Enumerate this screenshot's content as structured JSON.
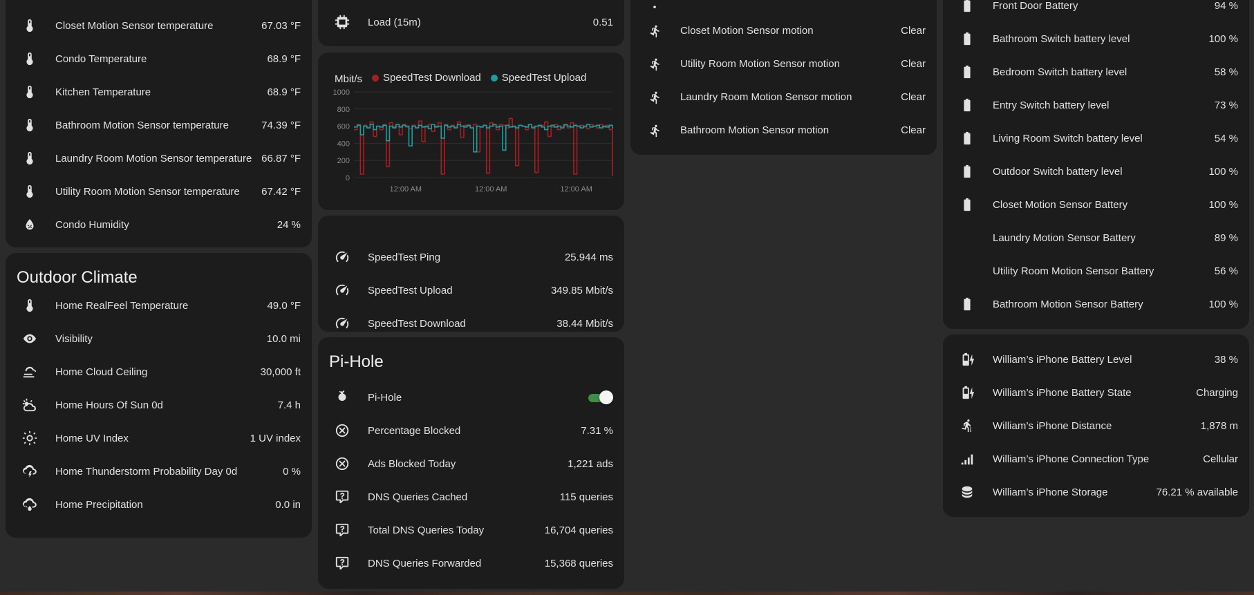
{
  "indoor": {
    "rows": [
      {
        "icon": "thermometer-icon",
        "label": "Closet Motion Sensor temperature",
        "value": "67.03 °F"
      },
      {
        "icon": "thermometer-icon",
        "label": "Condo Temperature",
        "value": "68.9 °F"
      },
      {
        "icon": "thermometer-icon",
        "label": "Kitchen Temperature",
        "value": "68.9 °F"
      },
      {
        "icon": "thermometer-icon",
        "label": "Bathroom Motion Sensor temperature",
        "value": "74.39 °F"
      },
      {
        "icon": "thermometer-icon",
        "label": "Laundry Room Motion Sensor temperature",
        "value": "66.87 °F"
      },
      {
        "icon": "thermometer-icon",
        "label": "Utility Room Motion Sensor temperature",
        "value": "67.42 °F"
      },
      {
        "icon": "water-percent-icon",
        "label": "Condo Humidity",
        "value": "24 %"
      }
    ]
  },
  "outdoor": {
    "title": "Outdoor Climate",
    "rows": [
      {
        "icon": "thermometer-icon",
        "label": "Home RealFeel Temperature",
        "value": "49.0 °F"
      },
      {
        "icon": "eye-icon",
        "label": "Visibility",
        "value": "10.0 mi"
      },
      {
        "icon": "weather-fog-icon",
        "label": "Home Cloud Ceiling",
        "value": "30,000 ft"
      },
      {
        "icon": "weather-partly-cloudy-icon",
        "label": "Home Hours Of Sun 0d",
        "value": "7.4 h"
      },
      {
        "icon": "sun-icon",
        "label": "Home UV Index",
        "value": "1 UV index"
      },
      {
        "icon": "weather-lightning-icon",
        "label": "Home Thunderstorm Probability Day 0d",
        "value": "0 %"
      },
      {
        "icon": "weather-rain-icon",
        "label": "Home Precipitation",
        "value": "0.0 in"
      }
    ]
  },
  "load": {
    "rows": [
      {
        "icon": "chip-icon",
        "label": "Load (15m)",
        "value": "0.51"
      }
    ]
  },
  "speedtest_chart": {
    "legend": [
      {
        "name": "SpeedTest Download",
        "color": "#a51e22"
      },
      {
        "name": "SpeedTest Upload",
        "color": "#1d9e9e"
      }
    ],
    "unit_label": "Mbit/s"
  },
  "chart_data": {
    "type": "line",
    "title": "",
    "ylabel": "Mbit/s",
    "ylim": [
      0,
      1000
    ],
    "yticks": [
      "1000",
      "800",
      "600",
      "400",
      "200",
      "0"
    ],
    "xticks": [
      "12:00 AM",
      "12:00 AM",
      "12:00 AM"
    ],
    "series": [
      {
        "name": "SpeedTest Download",
        "color": "#a51e22",
        "values": [
          560,
          620,
          40,
          610,
          580,
          650,
          480,
          600,
          560,
          620,
          130,
          640,
          590,
          600,
          500,
          620,
          590,
          570,
          610,
          580,
          660,
          420,
          590,
          620,
          540,
          600,
          640,
          40,
          620,
          560,
          610,
          590,
          650,
          470,
          610,
          600,
          580,
          620,
          300,
          590,
          610,
          50,
          640,
          600,
          560,
          620,
          610,
          580,
          690,
          590,
          140,
          610,
          600,
          560,
          620,
          590,
          60,
          600,
          610,
          650,
          480,
          590,
          620,
          560,
          600,
          610,
          580,
          640,
          40,
          600,
          610,
          590,
          570,
          620,
          600,
          580,
          620,
          590,
          610,
          560,
          20
        ]
      },
      {
        "name": "SpeedTest Upload",
        "color": "#1d9e9e",
        "values": [
          590,
          610,
          500,
          600,
          580,
          620,
          560,
          600,
          590,
          610,
          430,
          600,
          580,
          620,
          590,
          610,
          600,
          370,
          600,
          580,
          610,
          590,
          600,
          570,
          620,
          590,
          600,
          460,
          610,
          590,
          600,
          580,
          620,
          600,
          590,
          610,
          580,
          300,
          600,
          590,
          610,
          580,
          600,
          620,
          590,
          600,
          320,
          610,
          590,
          600,
          580,
          610,
          600,
          590,
          620,
          580,
          600,
          610,
          590,
          560,
          600,
          610,
          590,
          600,
          580,
          620,
          600,
          590,
          610,
          600,
          580,
          600,
          620,
          590,
          600,
          610,
          580,
          600,
          590,
          610,
          570
        ]
      }
    ]
  },
  "speedtest_stats": {
    "rows": [
      {
        "icon": "speedometer-icon",
        "label": "SpeedTest Ping",
        "value": "25.944 ms"
      },
      {
        "icon": "speedometer-icon",
        "label": "SpeedTest Upload",
        "value": "349.85 Mbit/s"
      },
      {
        "icon": "speedometer-icon",
        "label": "SpeedTest Download",
        "value": "38.44 Mbit/s"
      }
    ]
  },
  "pihole": {
    "title": "Pi-Hole",
    "toggle": {
      "icon": "pi-hole-icon",
      "label": "Pi-Hole",
      "state": "on"
    },
    "rows": [
      {
        "icon": "close-circle-icon",
        "label": "Percentage Blocked",
        "value": "7.31 %"
      },
      {
        "icon": "close-circle-icon",
        "label": "Ads Blocked Today",
        "value": "1,221 ads"
      },
      {
        "icon": "comment-question-icon",
        "label": "DNS Queries Cached",
        "value": "115 queries"
      },
      {
        "icon": "comment-question-icon",
        "label": "Total DNS Queries Today",
        "value": "16,704 queries"
      },
      {
        "icon": "comment-question-icon",
        "label": "DNS Queries Forwarded",
        "value": "15,368 queries"
      }
    ]
  },
  "motion": {
    "rows": [
      {
        "icon": "walk-icon",
        "label": "Closet Motion Sensor motion",
        "value": "Clear"
      },
      {
        "icon": "walk-icon",
        "label": "Utility Room Motion Sensor motion",
        "value": "Clear"
      },
      {
        "icon": "walk-icon",
        "label": "Laundry Room Motion Sensor motion",
        "value": "Clear"
      },
      {
        "icon": "walk-icon",
        "label": "Bathroom Motion Sensor motion",
        "value": "Clear"
      }
    ]
  },
  "batteries": {
    "rows": [
      {
        "icon": "battery-icon",
        "label": "Front Door Battery",
        "value": "94 %"
      },
      {
        "icon": "battery-icon",
        "label": "Bathroom Switch battery level",
        "value": "100 %"
      },
      {
        "icon": "battery-icon",
        "label": "Bedroom Switch battery level",
        "value": "58 %"
      },
      {
        "icon": "battery-icon",
        "label": "Entry Switch battery level",
        "value": "73 %"
      },
      {
        "icon": "battery-icon",
        "label": "Living Room Switch battery level",
        "value": "54 %"
      },
      {
        "icon": "battery-icon",
        "label": "Outdoor Switch battery level",
        "value": "100 %"
      },
      {
        "icon": "battery-icon",
        "label": "Closet Motion Sensor Battery",
        "value": "100 %"
      },
      {
        "icon": "",
        "label": "Laundry Motion Sensor Battery",
        "value": "89 %"
      },
      {
        "icon": "",
        "label": "Utility Room Motion Sensor Battery",
        "value": "56 %"
      },
      {
        "icon": "battery-icon",
        "label": "Bathroom Motion Sensor Battery",
        "value": "100 %"
      }
    ]
  },
  "iphone": {
    "rows": [
      {
        "icon": "battery-charging-icon",
        "label": "William’s iPhone Battery Level",
        "value": "38 %"
      },
      {
        "icon": "battery-charging-icon",
        "label": "William’s iPhone Battery State",
        "value": "Charging"
      },
      {
        "icon": "hiking-icon",
        "label": "William’s iPhone Distance",
        "value": "1,878 m"
      },
      {
        "icon": "signal-icon",
        "label": "William’s iPhone Connection Type",
        "value": "Cellular"
      },
      {
        "icon": "database-icon",
        "label": "William’s iPhone Storage",
        "value": "76.21 % available"
      }
    ]
  }
}
